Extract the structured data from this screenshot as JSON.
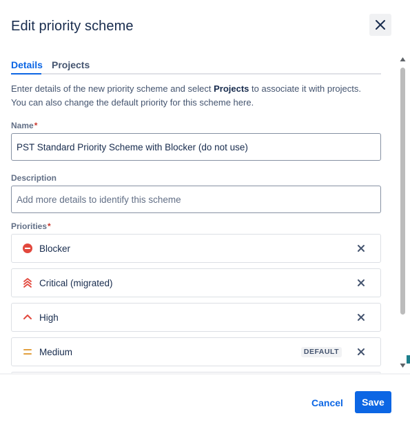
{
  "dialog": {
    "title": "Edit priority scheme",
    "close_icon": "close-icon"
  },
  "tabs": [
    {
      "label": "Details",
      "active": true
    },
    {
      "label": "Projects",
      "active": false
    }
  ],
  "intro": {
    "part1": "Enter details of the new priority scheme and select ",
    "bold": "Projects",
    "part2": " to associate it with projects. You can also change the default priority for this scheme here."
  },
  "form": {
    "name_label": "Name",
    "name_value": "PST Standard Priority Scheme with Blocker (do not use)",
    "description_label": "Description",
    "description_placeholder": "Add more details to identify this scheme",
    "priorities_label": "Priorities",
    "required_marker": "*"
  },
  "priorities": [
    {
      "label": "Blocker",
      "icon": "blocker-icon",
      "color": "#e2483d",
      "default": false
    },
    {
      "label": "Critical (migrated)",
      "icon": "critical-icon",
      "color": "#e2483d",
      "default": false
    },
    {
      "label": "High",
      "icon": "high-icon",
      "color": "#e2483d",
      "default": false
    },
    {
      "label": "Medium",
      "icon": "medium-icon",
      "color": "#e2a03f",
      "default": true,
      "badge": "DEFAULT"
    }
  ],
  "footer": {
    "cancel_label": "Cancel",
    "save_label": "Save"
  },
  "colors": {
    "accent": "#0c66e4",
    "danger": "#c9372c",
    "text": "#172b4d"
  }
}
